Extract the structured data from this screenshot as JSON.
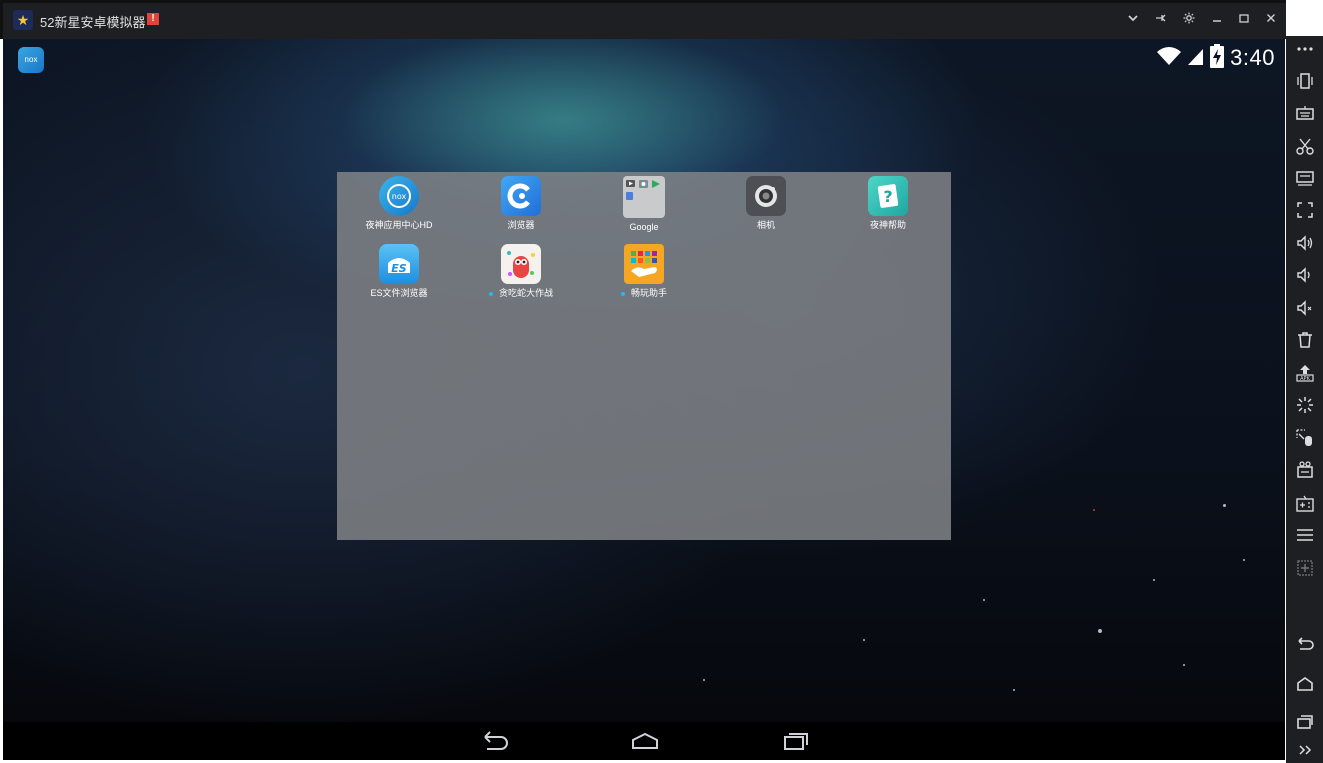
{
  "window": {
    "title": "52新星安卓模拟器",
    "alert_badge": "!",
    "controls": [
      "chevron-down-icon",
      "pin-icon",
      "gear-icon",
      "minimize-icon",
      "maximize-icon",
      "close-icon"
    ]
  },
  "statusbar": {
    "left_icon": "nox-icon",
    "clock": "3:40",
    "icons": [
      "wifi-icon",
      "signal-icon",
      "battery-charging-icon"
    ]
  },
  "folder": {
    "apps": [
      {
        "label": "夜神应用中心HD",
        "icon": "nox-appcenter-icon",
        "new": false
      },
      {
        "label": "浏览器",
        "icon": "browser-icon",
        "new": false
      },
      {
        "label": "Google",
        "icon": "google-folder-icon",
        "new": false
      },
      {
        "label": "相机",
        "icon": "camera-icon",
        "new": false
      },
      {
        "label": "夜神帮助",
        "icon": "help-icon",
        "new": false
      },
      {
        "label": "ES文件浏览器",
        "icon": "es-file-explorer-icon",
        "new": false
      },
      {
        "label": "贪吃蛇大作战",
        "icon": "snake-game-icon",
        "new": true
      },
      {
        "label": "畅玩助手",
        "icon": "play-assistant-icon",
        "new": true
      }
    ]
  },
  "navbar": [
    "back-icon",
    "home-icon",
    "recents-icon"
  ],
  "sidebar": {
    "tools": [
      "more-icon",
      "shake-icon",
      "keyboard-icon",
      "scissors-icon",
      "screen-icon",
      "fullscreen-icon",
      "volume-up-icon",
      "volume-down-icon",
      "mute-icon",
      "trash-icon",
      "apk-install-icon",
      "loading-icon",
      "macro-icon",
      "video-record-icon",
      "multi-instance-icon",
      "menu-icon",
      "add-icon"
    ],
    "bottom": [
      "back-icon",
      "home-icon",
      "recents-icon",
      "expand-icon"
    ]
  },
  "colors": {
    "titlebar": "#1e1f22",
    "panel": "#808286",
    "accent_blue": "#29b6f6",
    "alert": "#e0423c"
  }
}
